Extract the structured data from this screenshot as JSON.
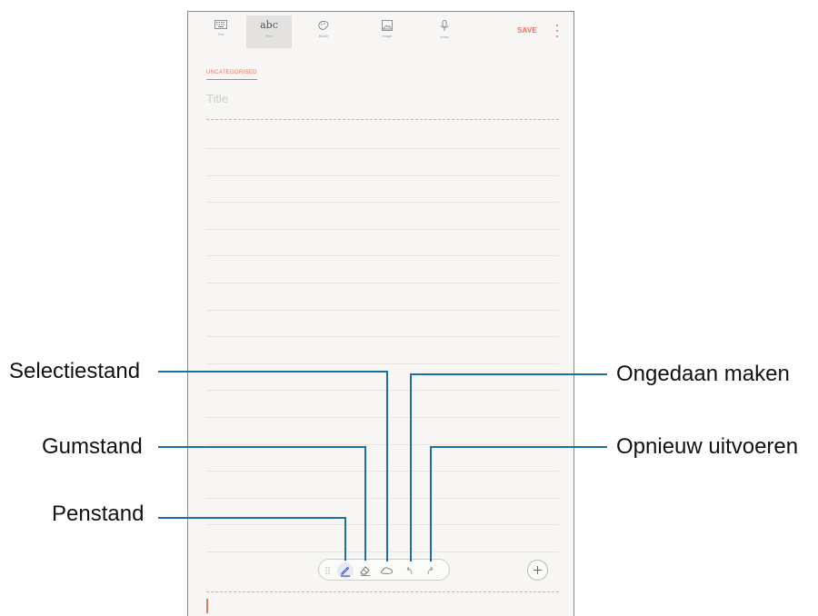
{
  "toolbar": {
    "tools": [
      {
        "name": "keyboard-tool",
        "label": "Text",
        "icon": "keyboard-icon"
      },
      {
        "name": "handwriting-tool",
        "label": "Pen",
        "icon": "abc-icon",
        "glyph": "abc",
        "active": true
      },
      {
        "name": "brush-tool",
        "label": "Brush",
        "icon": "brush-icon"
      },
      {
        "name": "image-tool",
        "label": "Image",
        "icon": "image-icon"
      },
      {
        "name": "voice-tool",
        "label": "Voice",
        "icon": "microphone-icon"
      }
    ],
    "save_label": "SAVE",
    "more_icon": "more-vertical-icon"
  },
  "note": {
    "category": "UNCATEGORISED",
    "title_placeholder": "Title"
  },
  "pen_toolbar": {
    "items": [
      "grip-icon",
      "pen-icon",
      "eraser-icon",
      "lasso-icon",
      "undo-icon",
      "redo-icon"
    ],
    "add_icon": "plus-icon"
  },
  "callouts": {
    "selection_mode": "Selectiestand",
    "eraser_mode": "Gumstand",
    "pen_mode": "Penstand",
    "undo": "Ongedaan maken",
    "redo": "Opnieuw uitvoeren"
  },
  "colors": {
    "accent": "#e8725c",
    "callout_line": "#1b6fa3",
    "pen_blue": "#3b4ea8"
  }
}
